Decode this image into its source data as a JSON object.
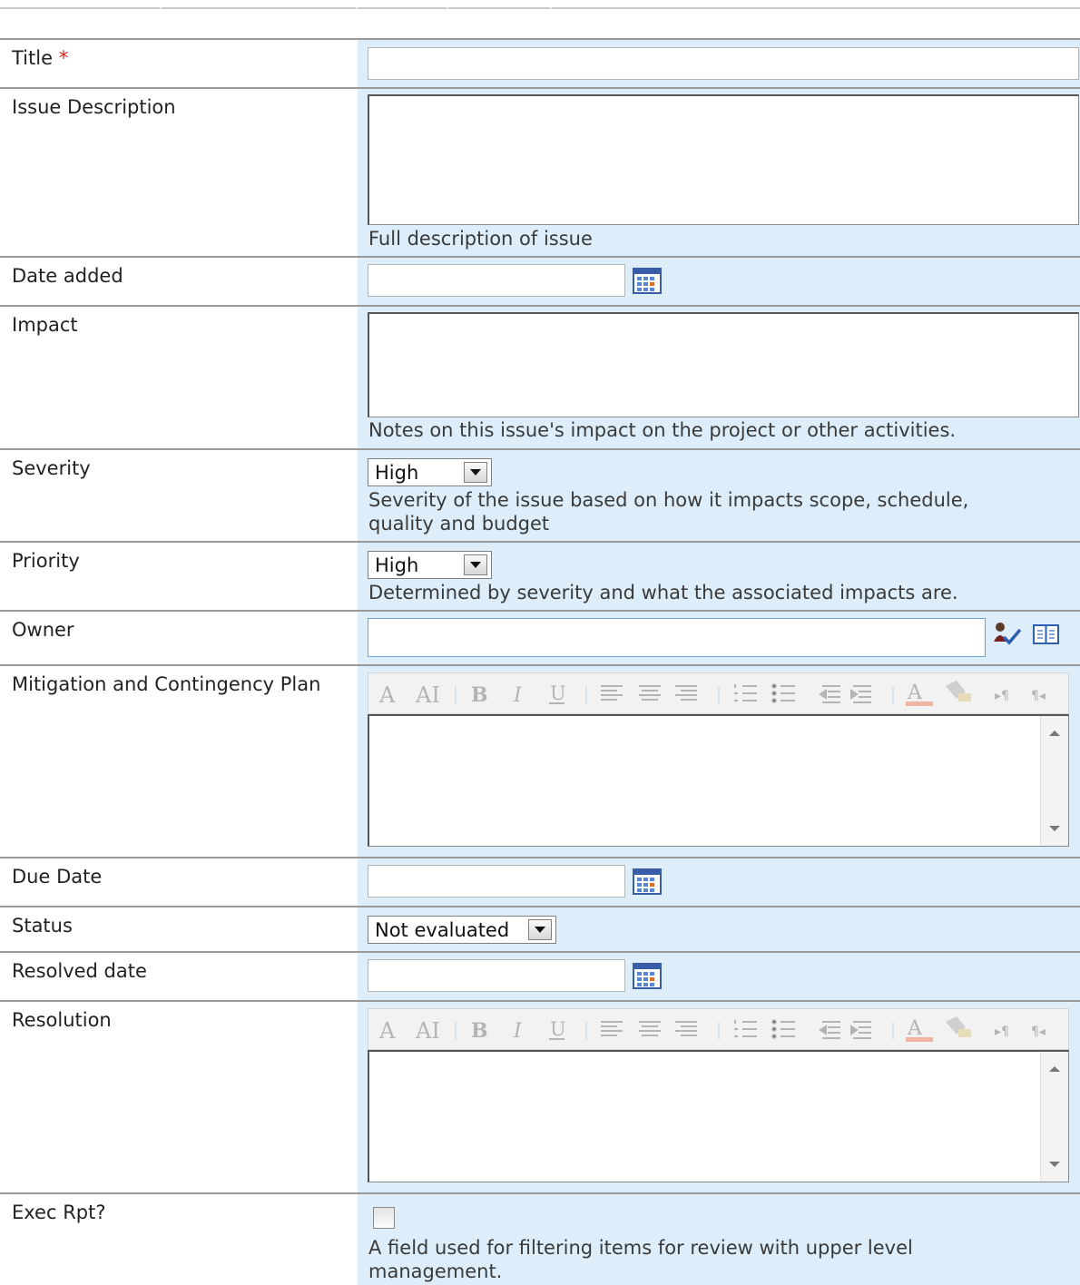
{
  "form": {
    "fields": [
      {
        "label": "Title",
        "required_marker": "*",
        "type": "text",
        "value": ""
      },
      {
        "label": "Issue Description",
        "type": "multiline",
        "value": "",
        "description": "Full description of issue"
      },
      {
        "label": "Date added",
        "type": "date",
        "value": ""
      },
      {
        "label": "Impact",
        "type": "multiline",
        "value": "",
        "description": "Notes on this issue's impact on the project or other activities."
      },
      {
        "label": "Severity",
        "type": "select",
        "value": "High",
        "description_lines": [
          "Severity of the issue based on how it impacts scope, schedule,",
          "quality and budget"
        ]
      },
      {
        "label": "Priority",
        "type": "select",
        "value": "High",
        "description": "Determined by severity and what the associated impacts are."
      },
      {
        "label": "Owner",
        "type": "people-picker",
        "value": ""
      },
      {
        "label": "Mitigation and Contingency Plan",
        "type": "rich-text",
        "value": ""
      },
      {
        "label": "Due Date",
        "type": "date",
        "value": ""
      },
      {
        "label": "Status",
        "type": "select",
        "value": "Not evaluated"
      },
      {
        "label": "Resolved date",
        "type": "date",
        "value": ""
      },
      {
        "label": "Resolution",
        "type": "rich-text",
        "value": ""
      },
      {
        "label": "Exec Rpt?",
        "type": "checkbox",
        "checked": false,
        "description_lines": [
          "A field used for filtering items for review with upper level",
          "management."
        ]
      }
    ]
  },
  "toolbar_icons": [
    "font-icon",
    "font-size-icon",
    "bold-icon",
    "italic-icon",
    "underline-icon",
    "align-left-icon",
    "align-center-icon",
    "align-right-icon",
    "numbered-list-icon",
    "bulleted-list-icon",
    "decrease-indent-icon",
    "increase-indent-icon",
    "text-color-icon",
    "highlight-color-icon",
    "ltr-icon",
    "rtl-icon"
  ],
  "colors": {
    "value_column_bg": "#ddeefa",
    "required_marker": "#e02020",
    "focused_input_border": "#6aa6db"
  }
}
